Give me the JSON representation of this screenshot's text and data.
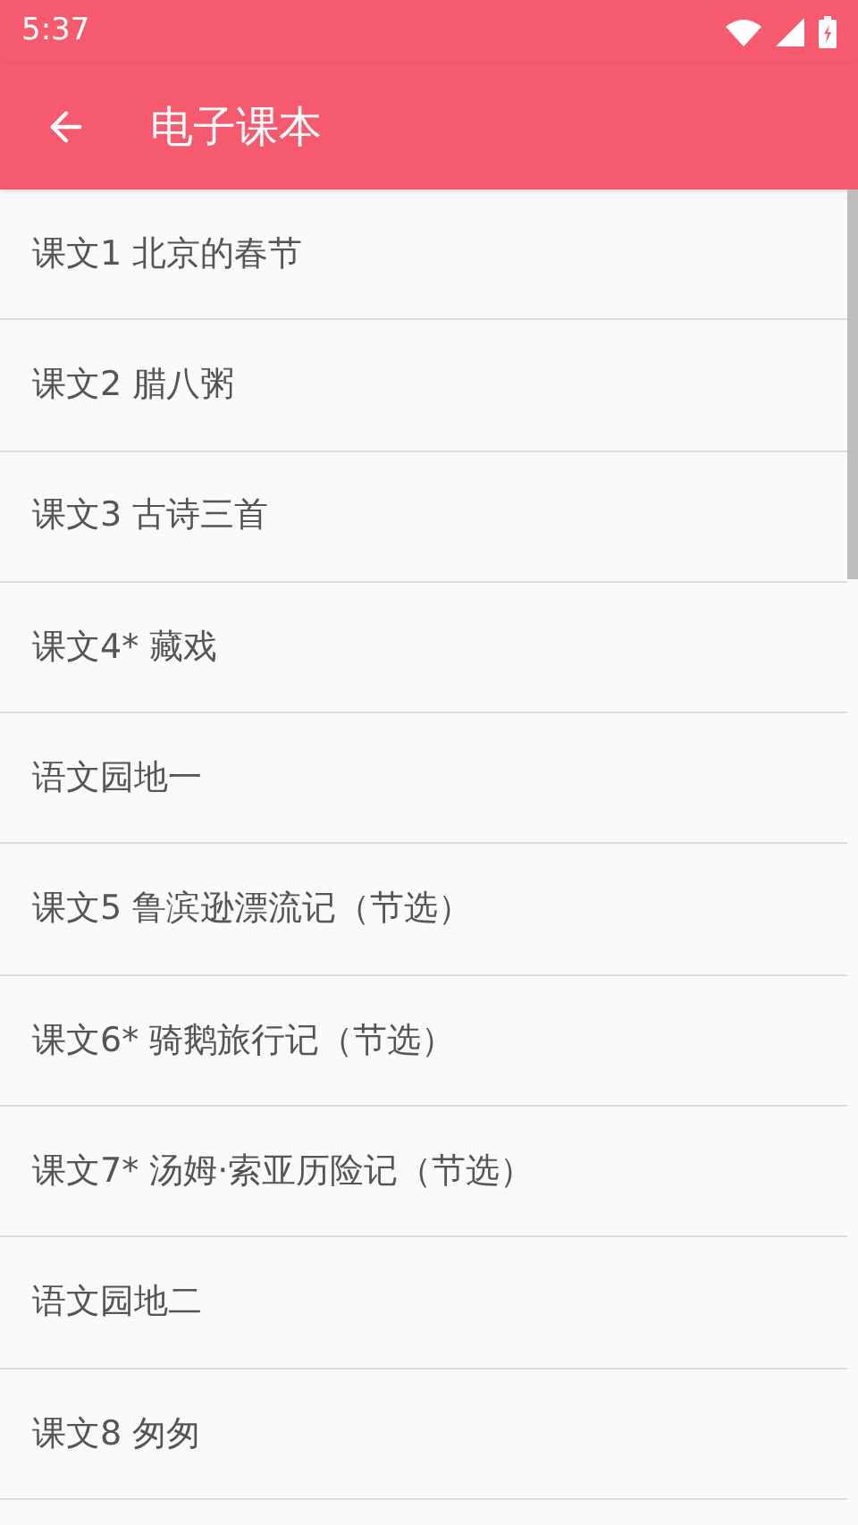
{
  "status_bar": {
    "time": "5:37"
  },
  "toolbar": {
    "title": "电子课本"
  },
  "lessons": [
    {
      "title": "课文1 北京的春节"
    },
    {
      "title": "课文2 腊八粥"
    },
    {
      "title": "课文3 古诗三首"
    },
    {
      "title": "课文4* 藏戏"
    },
    {
      "title": "语文园地一"
    },
    {
      "title": "课文5 鲁滨逊漂流记（节选）"
    },
    {
      "title": "课文6* 骑鹅旅行记（节选）"
    },
    {
      "title": "课文7* 汤姆·索亚历险记（节选）"
    },
    {
      "title": "语文园地二"
    },
    {
      "title": "课文8 匆匆"
    }
  ]
}
